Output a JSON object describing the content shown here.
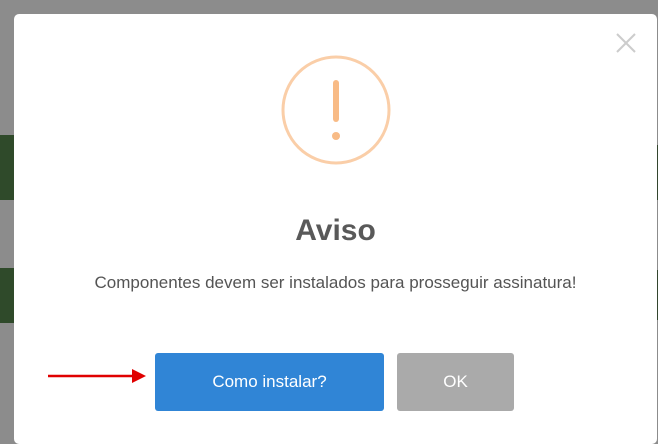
{
  "dialog": {
    "close_icon": "close-icon",
    "status_icon": "warning-exclamation-icon",
    "icon_color": "#f8bb86",
    "title": "Aviso",
    "message": "Componentes devem ser instalados para prosseguir assinatura!",
    "buttons": {
      "how_to_install": "Como instalar?",
      "ok": "OK"
    },
    "primary_color": "#3085d6",
    "secondary_color": "#aaaaaa"
  },
  "annotation": {
    "arrow_icon": "red-arrow-icon",
    "color": "#e00000"
  }
}
